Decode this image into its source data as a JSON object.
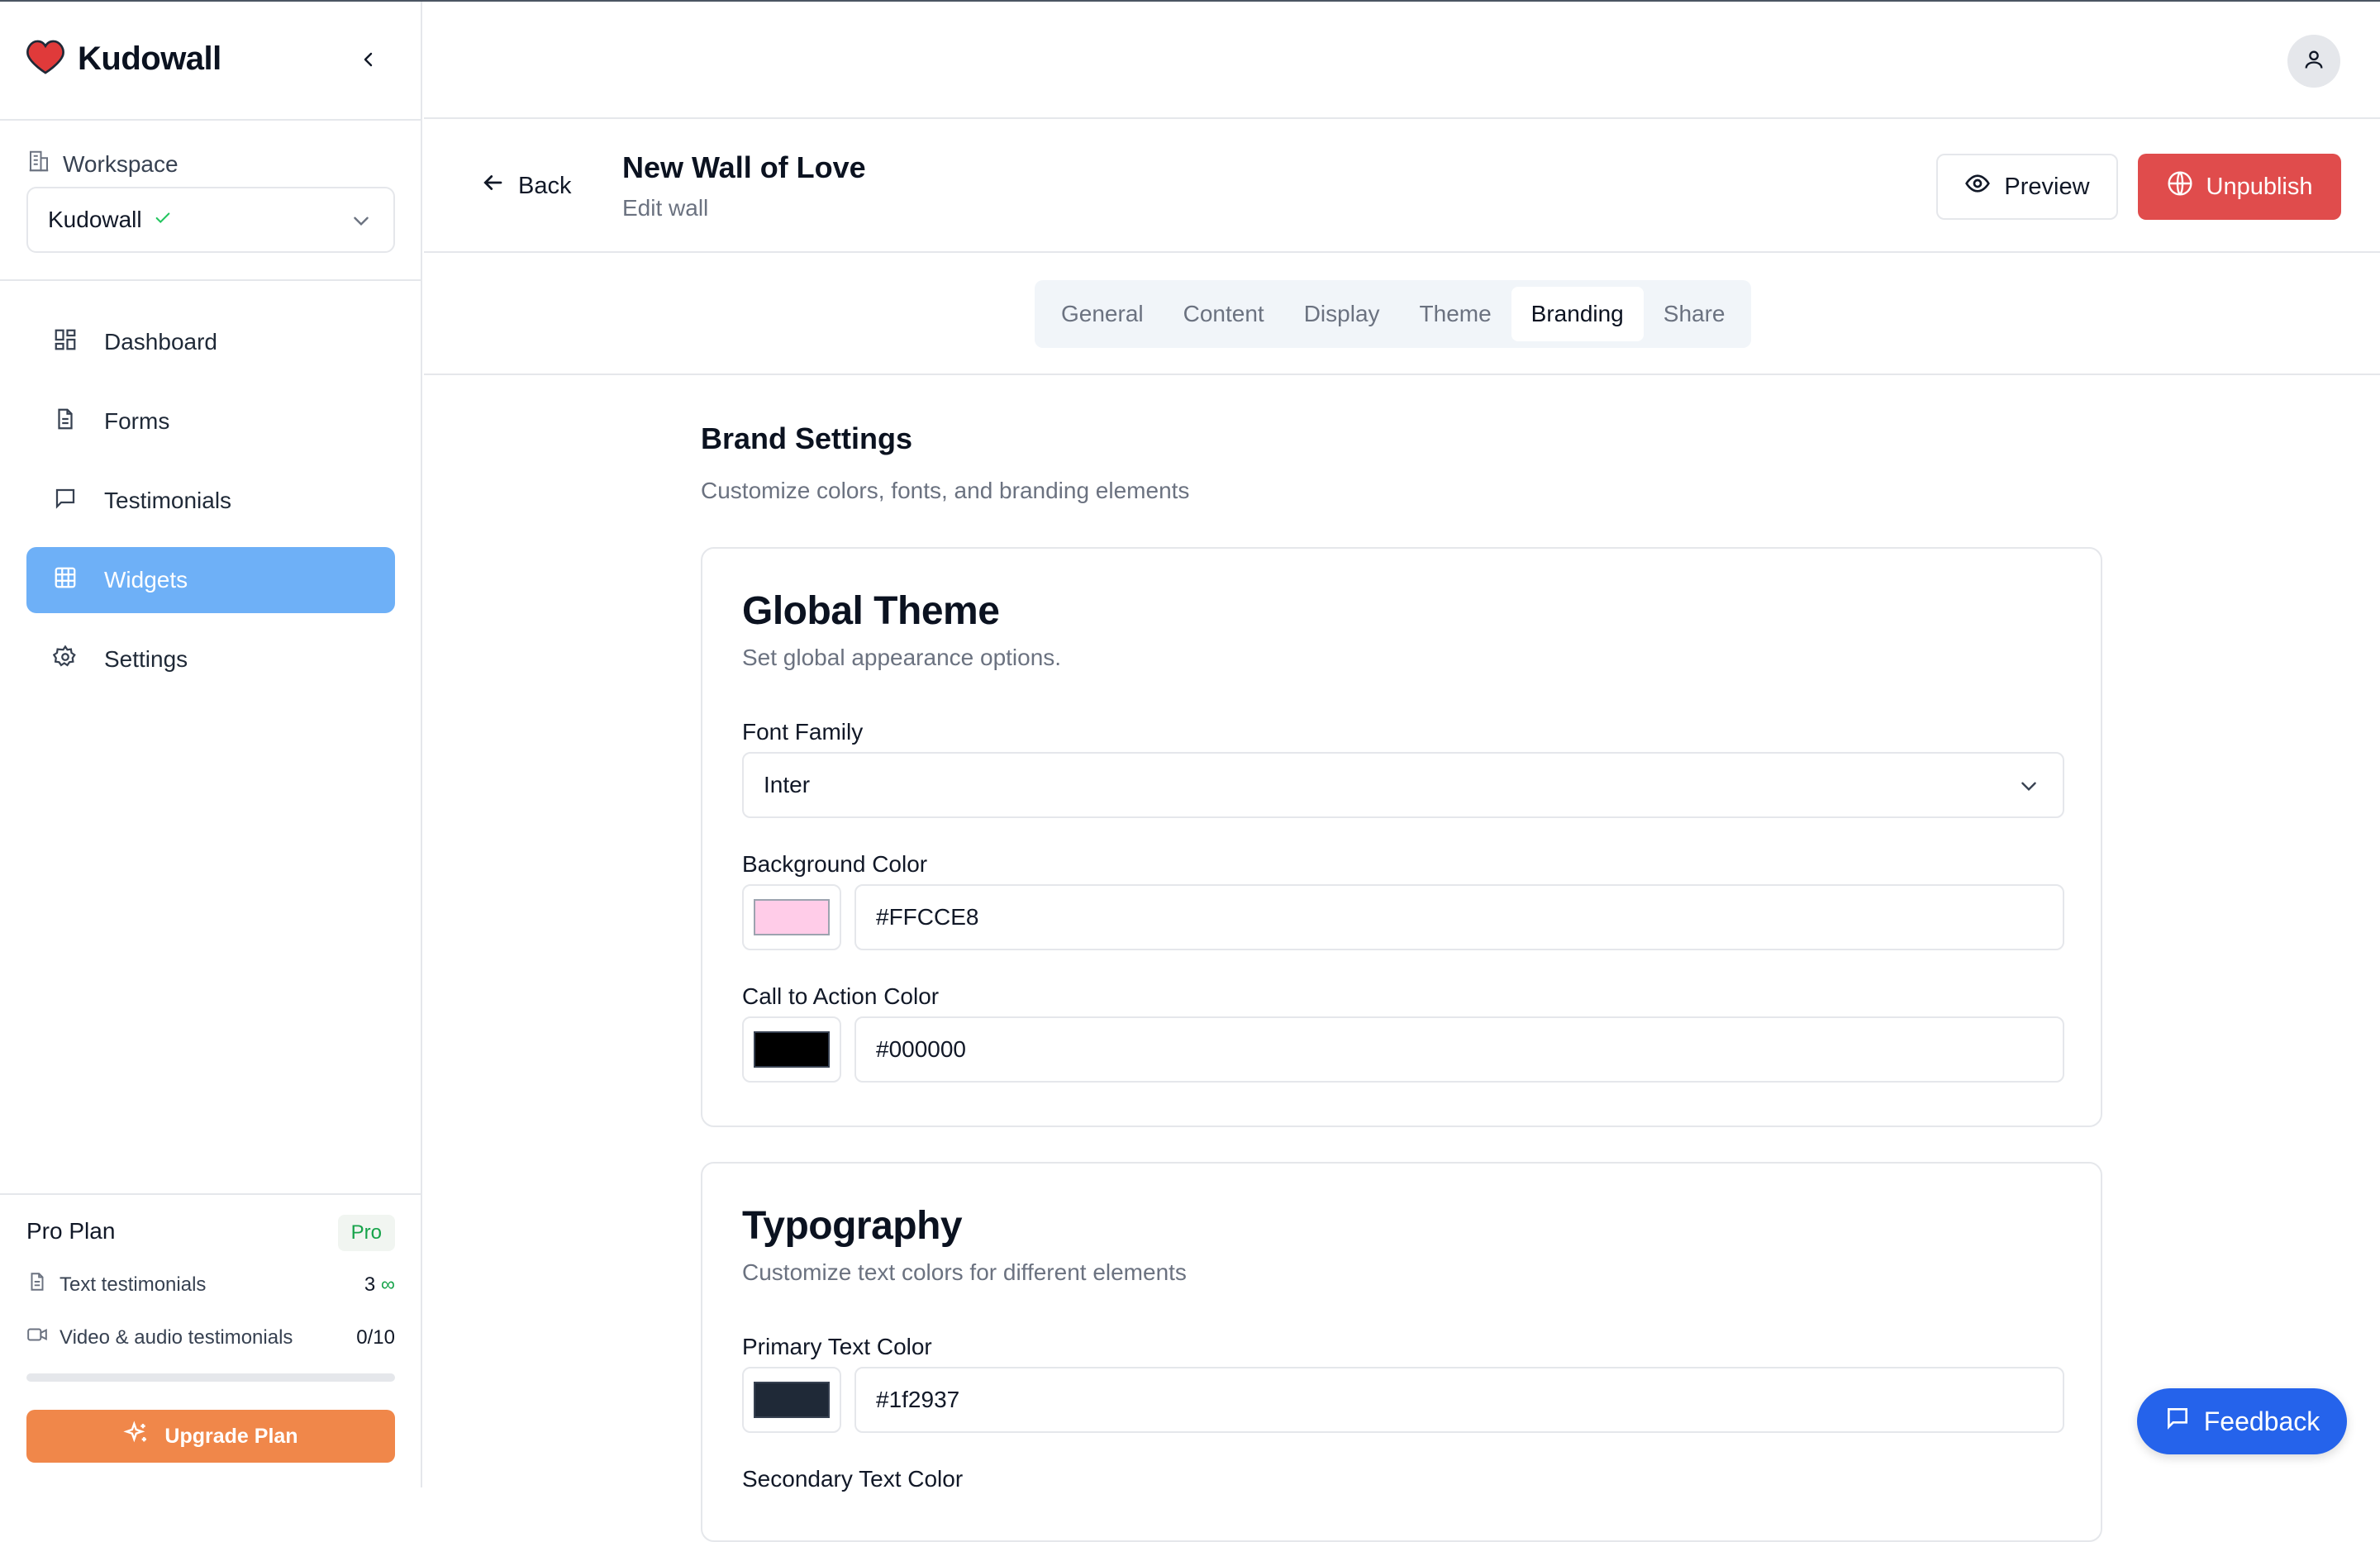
{
  "app": {
    "name": "Kudowall",
    "brand_color": "#e04040"
  },
  "sidebar": {
    "workspace_label": "Workspace",
    "workspace_value": "Kudowall",
    "nav": [
      {
        "label": "Dashboard",
        "icon": "dashboard-icon"
      },
      {
        "label": "Forms",
        "icon": "file-icon"
      },
      {
        "label": "Testimonials",
        "icon": "message-icon"
      },
      {
        "label": "Widgets",
        "icon": "grid-icon",
        "active": true
      },
      {
        "label": "Settings",
        "icon": "gear-icon"
      }
    ],
    "plan": {
      "title": "Pro Plan",
      "badge": "Pro",
      "text_label": "Text testimonials",
      "text_value": "3",
      "text_unlimited": "∞",
      "video_label": "Video & audio testimonials",
      "video_value": "0/10",
      "video_progress": 0,
      "upgrade_label": "Upgrade Plan"
    }
  },
  "header": {
    "back_label": "Back",
    "title": "New Wall of Love",
    "subtitle": "Edit wall",
    "preview_label": "Preview",
    "unpublish_label": "Unpublish"
  },
  "tabs": [
    {
      "label": "General"
    },
    {
      "label": "Content"
    },
    {
      "label": "Display"
    },
    {
      "label": "Theme"
    },
    {
      "label": "Branding",
      "active": true
    },
    {
      "label": "Share"
    }
  ],
  "brand": {
    "title": "Brand Settings",
    "subtitle": "Customize colors, fonts, and branding elements"
  },
  "global_theme": {
    "title": "Global Theme",
    "subtitle": "Set global appearance options.",
    "font_label": "Font Family",
    "font_value": "Inter",
    "bg_label": "Background Color",
    "bg_value": "#FFCCE8",
    "cta_label": "Call to Action Color",
    "cta_value": "#000000"
  },
  "typography": {
    "title": "Typography",
    "subtitle": "Customize text colors for different elements",
    "primary_label": "Primary Text Color",
    "primary_value": "#1f2937",
    "secondary_label": "Secondary Text Color"
  },
  "feedback_label": "Feedback"
}
